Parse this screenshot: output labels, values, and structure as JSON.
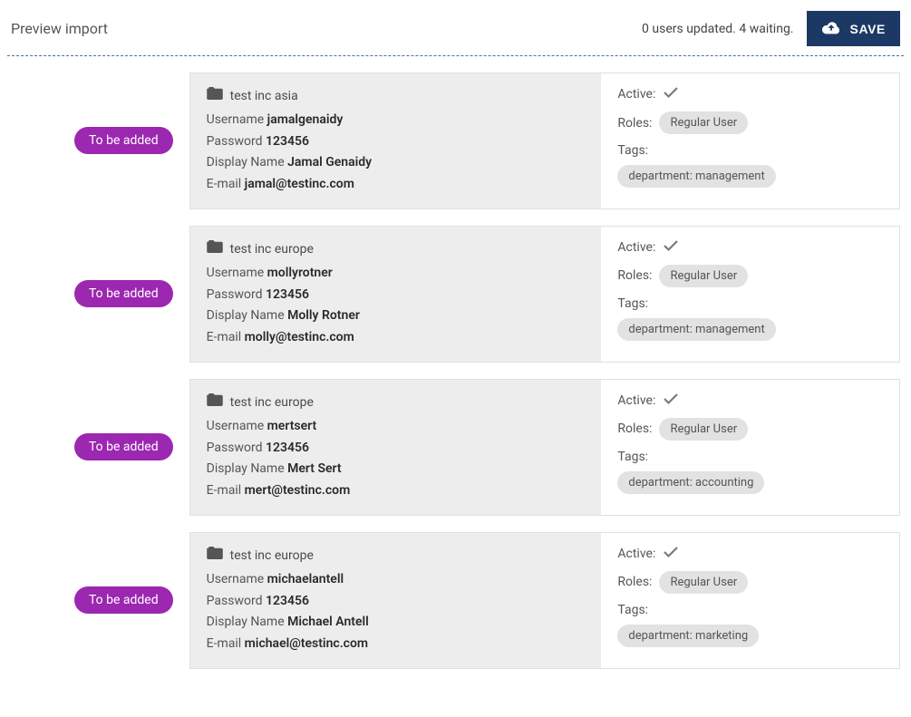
{
  "header": {
    "title": "Preview import",
    "status": "0 users updated. 4 waiting.",
    "save_label": "SAVE"
  },
  "badge_label": "To be added",
  "labels": {
    "username": "Username",
    "password": "Password",
    "display_name": "Display Name",
    "email": "E-mail",
    "active": "Active:",
    "roles": "Roles:",
    "tags": "Tags:"
  },
  "users": [
    {
      "org": "test inc asia",
      "username": "jamalgenaidy",
      "password": "123456",
      "display_name": "Jamal Genaidy",
      "email": "jamal@testinc.com",
      "role": "Regular User",
      "tag": "department: management"
    },
    {
      "org": "test inc europe",
      "username": "mollyrotner",
      "password": "123456",
      "display_name": "Molly Rotner",
      "email": "molly@testinc.com",
      "role": "Regular User",
      "tag": "department: management"
    },
    {
      "org": "test inc europe",
      "username": "mertsert",
      "password": "123456",
      "display_name": "Mert Sert",
      "email": "mert@testinc.com",
      "role": "Regular User",
      "tag": "department: accounting"
    },
    {
      "org": "test inc europe",
      "username": "michaelantell",
      "password": "123456",
      "display_name": "Michael Antell",
      "email": "michael@testinc.com",
      "role": "Regular User",
      "tag": "department: marketing"
    }
  ]
}
